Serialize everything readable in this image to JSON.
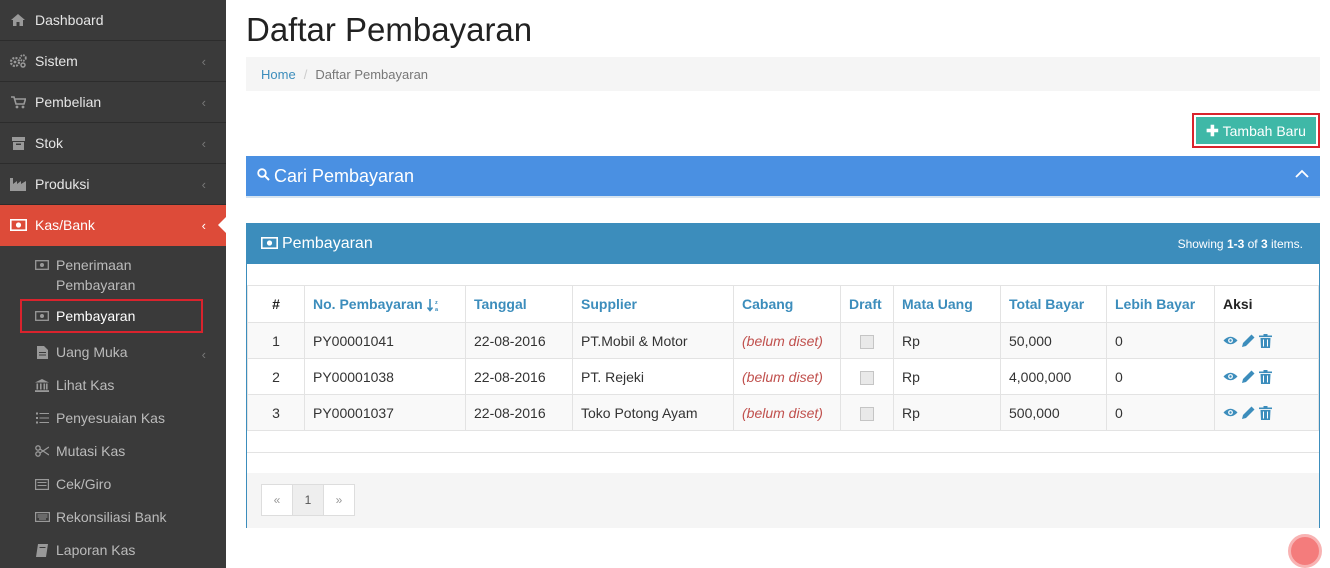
{
  "sidebar": {
    "items": [
      {
        "label": "Dashboard",
        "icon": "home-icon"
      },
      {
        "label": "Sistem",
        "icon": "gears-icon"
      },
      {
        "label": "Pembelian",
        "icon": "cart-icon"
      },
      {
        "label": "Stok",
        "icon": "box-icon"
      },
      {
        "label": "Produksi",
        "icon": "factory-icon"
      },
      {
        "label": "Kas/Bank",
        "icon": "money-icon"
      }
    ],
    "sub_items": [
      {
        "label": "Penerimaan Pembayaran",
        "icon": "money-icon"
      },
      {
        "label": "Pembayaran",
        "icon": "money-icon"
      },
      {
        "label": "Uang Muka",
        "icon": "file-icon"
      },
      {
        "label": "Lihat Kas",
        "icon": "bank-icon"
      },
      {
        "label": "Penyesuaian Kas",
        "icon": "list-icon"
      },
      {
        "label": "Mutasi Kas",
        "icon": "scissors-icon"
      },
      {
        "label": "Cek/Giro",
        "icon": "cheque-icon"
      },
      {
        "label": "Rekonsiliasi Bank",
        "icon": "keyboard-icon"
      },
      {
        "label": "Laporan Kas",
        "icon": "book-icon"
      }
    ]
  },
  "page": {
    "title": "Daftar Pembayaran",
    "breadcrumb": {
      "home": "Home",
      "separator": "/",
      "current": "Daftar Pembayaran"
    },
    "add_button": "Tambah Baru",
    "search_panel_title": "Cari Pembayaran"
  },
  "grid": {
    "title": "Pembayaran",
    "summary_prefix": "Showing ",
    "summary_range": "1-3",
    "summary_of": " of ",
    "summary_total": "3",
    "summary_suffix": " items.",
    "headers": {
      "num": "#",
      "no": "No. Pembayaran",
      "tanggal": "Tanggal",
      "supplier": "Supplier",
      "cabang": "Cabang",
      "draft": "Draft",
      "mata_uang": "Mata Uang",
      "total": "Total Bayar",
      "lebih": "Lebih Bayar",
      "aksi": "Aksi"
    },
    "rows": [
      {
        "num": "1",
        "no": "PY00001041",
        "tanggal": "22-08-2016",
        "supplier": "PT.Mobil & Motor",
        "cabang": "(belum diset)",
        "mata_uang": "Rp",
        "total": "50,000",
        "lebih": "0"
      },
      {
        "num": "2",
        "no": "PY00001038",
        "tanggal": "22-08-2016",
        "supplier": "PT. Rejeki",
        "cabang": "(belum diset)",
        "mata_uang": "Rp",
        "total": "4,000,000",
        "lebih": "0"
      },
      {
        "num": "3",
        "no": "PY00001037",
        "tanggal": "22-08-2016",
        "supplier": "Toko Potong Ayam",
        "cabang": "(belum diset)",
        "mata_uang": "Rp",
        "total": "500,000",
        "lebih": "0"
      }
    ],
    "pager": {
      "prev": "«",
      "page": "1",
      "next": "»"
    }
  },
  "colors": {
    "sidebar_bg": "#3a3a3a",
    "active": "#dd4b39",
    "primary": "#3c8dbc",
    "search_bg": "#4a90e2",
    "add_button": "#3fb8a7",
    "highlight_border": "#d9232d"
  }
}
